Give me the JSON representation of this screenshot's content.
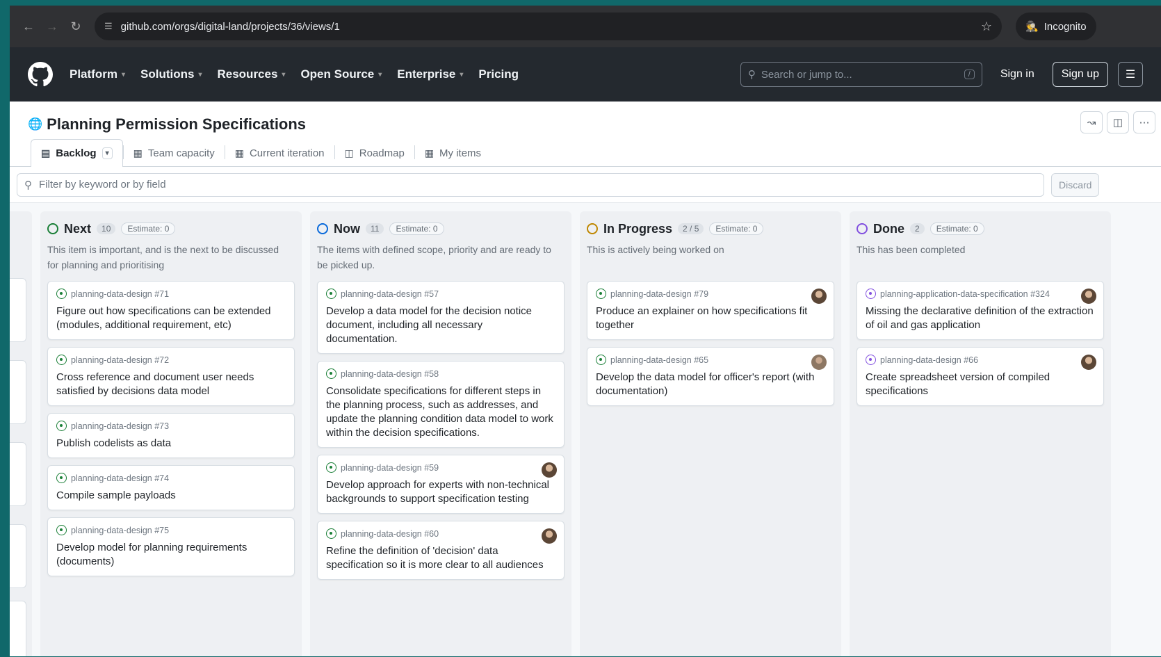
{
  "browser": {
    "url": "github.com/orgs/digital-land/projects/36/views/1",
    "profile_label": "Incognito"
  },
  "header": {
    "menu": [
      {
        "label": "Platform",
        "has_chevron": true
      },
      {
        "label": "Solutions",
        "has_chevron": true
      },
      {
        "label": "Resources",
        "has_chevron": true
      },
      {
        "label": "Open Source",
        "has_chevron": true
      },
      {
        "label": "Enterprise",
        "has_chevron": true
      },
      {
        "label": "Pricing",
        "has_chevron": false
      }
    ],
    "search_placeholder": "Search or jump to...",
    "search_shortcut": "/",
    "sign_in": "Sign in",
    "sign_up": "Sign up"
  },
  "project": {
    "title": "Planning Permission Specifications",
    "tabs": [
      {
        "label": "Backlog",
        "active": true
      },
      {
        "label": "Team capacity",
        "active": false
      },
      {
        "label": "Current iteration",
        "active": false
      },
      {
        "label": "Roadmap",
        "active": false
      },
      {
        "label": "My items",
        "active": false
      }
    ],
    "filter_placeholder": "Filter by keyword or by field",
    "discard_label": "Discard"
  },
  "columns": [
    {
      "name": "Next",
      "count": "10",
      "estimate": "Estimate: 0",
      "status_color": "#1a7f37",
      "description": "This item is important, and is the next to be discussed for planning and prioritising",
      "cards": [
        {
          "repo": "planning-data-design #71",
          "title": "Figure out how specifications can be extended (modules, additional requirement, etc)",
          "avatar": false,
          "icon": "green"
        },
        {
          "repo": "planning-data-design #72",
          "title": "Cross reference and document user needs satisfied by decisions data model",
          "avatar": false,
          "icon": "green"
        },
        {
          "repo": "planning-data-design #73",
          "title": "Publish codelists as data",
          "avatar": false,
          "icon": "green"
        },
        {
          "repo": "planning-data-design #74",
          "title": "Compile sample payloads",
          "avatar": false,
          "icon": "green"
        },
        {
          "repo": "planning-data-design #75",
          "title": "Develop model for planning requirements (documents)",
          "avatar": false,
          "icon": "green"
        }
      ]
    },
    {
      "name": "Now",
      "count": "11",
      "estimate": "Estimate: 0",
      "status_color": "#0969da",
      "description": "The items with defined scope, priority and are ready to be picked up.",
      "cards": [
        {
          "repo": "planning-data-design #57",
          "title": "Develop a data model for the decision notice document, including all necessary documentation.",
          "avatar": false,
          "icon": "green"
        },
        {
          "repo": "planning-data-design #58",
          "title": "Consolidate specifications for different steps in the planning process, such as addresses, and update the planning condition data model to work within the decision specifications.",
          "avatar": false,
          "icon": "green"
        },
        {
          "repo": "planning-data-design #59",
          "title": "Develop approach for experts with non-technical backgrounds to support specification testing",
          "avatar": true,
          "icon": "green"
        },
        {
          "repo": "planning-data-design #60",
          "title": "Refine the definition of 'decision' data specification so it is more clear to all audiences",
          "avatar": true,
          "icon": "green"
        }
      ]
    },
    {
      "name": "In Progress",
      "count": "2 / 5",
      "estimate": "Estimate: 0",
      "status_color": "#bf8700",
      "description": "This is actively being worked on",
      "cards": [
        {
          "repo": "planning-data-design #79",
          "title": "Produce an explainer on how specifications fit together",
          "avatar": true,
          "icon": "green"
        },
        {
          "repo": "planning-data-design #65",
          "title": "Develop the data model for officer's report (with documentation)",
          "avatar": true,
          "icon": "green"
        }
      ]
    },
    {
      "name": "Done",
      "count": "2",
      "estimate": "Estimate: 0",
      "status_color": "#8250df",
      "description": "This has been completed",
      "cards": [
        {
          "repo": "planning-application-data-specification #324",
          "title": "Missing the declarative definition of the extraction of oil and gas application",
          "avatar": true,
          "icon": "purple"
        },
        {
          "repo": "planning-data-design #66",
          "title": "Create spreadsheet version of compiled specifications",
          "avatar": true,
          "icon": "purple"
        }
      ]
    }
  ]
}
